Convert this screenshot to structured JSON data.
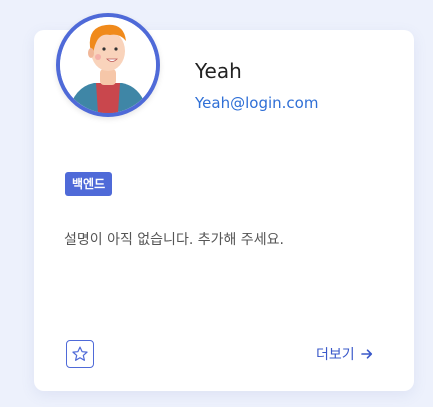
{
  "profile": {
    "name": "Yeah",
    "email": "Yeah@login.com",
    "avatar_icon": "person-avatar-icon"
  },
  "tag": {
    "label": "백엔드"
  },
  "description": "설명이 아직 없습니다. 추가해 주세요.",
  "actions": {
    "favorite_icon": "star-icon",
    "more_label": "더보기",
    "more_icon": "arrow-right-icon"
  },
  "colors": {
    "accent": "#4f6ad8",
    "link": "#2f6fd6",
    "background": "#edf1fc"
  }
}
